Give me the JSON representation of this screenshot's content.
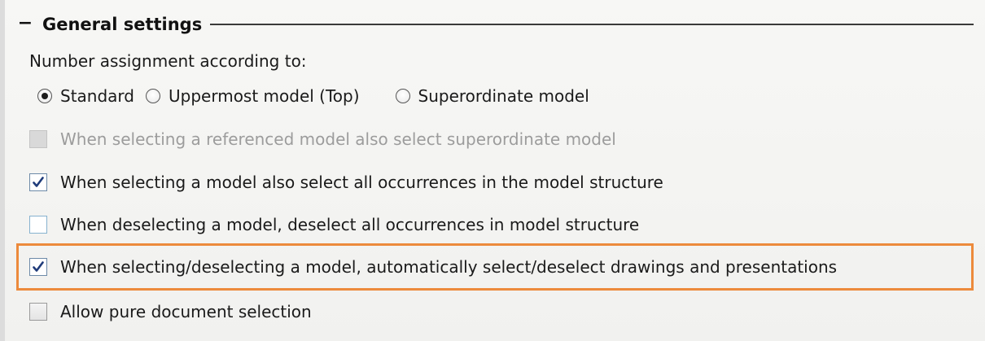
{
  "group": {
    "collapse_glyph": "−",
    "title": "General settings"
  },
  "number_assignment": {
    "label": "Number assignment according to:",
    "options": [
      {
        "label": "Standard",
        "selected": true
      },
      {
        "label": "Uppermost model (Top)",
        "selected": false
      },
      {
        "label": "Superordinate model",
        "selected": false
      }
    ]
  },
  "checkboxes": [
    {
      "label": "When selecting a referenced model also select superordinate model",
      "checked": false,
      "enabled": false
    },
    {
      "label": "When selecting a model also select all occurrences in the model structure",
      "checked": true,
      "enabled": true
    },
    {
      "label": "When deselecting a model, deselect all occurrences in model structure",
      "checked": false,
      "enabled": true
    },
    {
      "label": "When selecting/deselecting a model, automatically select/deselect drawings and presentations",
      "checked": true,
      "enabled": true,
      "highlighted": true
    },
    {
      "label": "Allow pure document selection",
      "checked": false,
      "enabled": true
    }
  ],
  "colors": {
    "highlight": "#ec8a3c",
    "checkmark": "#1f3b7a",
    "disabled_text": "#9c9c9c"
  },
  "icons": {
    "check": "checkmark-icon",
    "collapse": "minus-icon"
  }
}
